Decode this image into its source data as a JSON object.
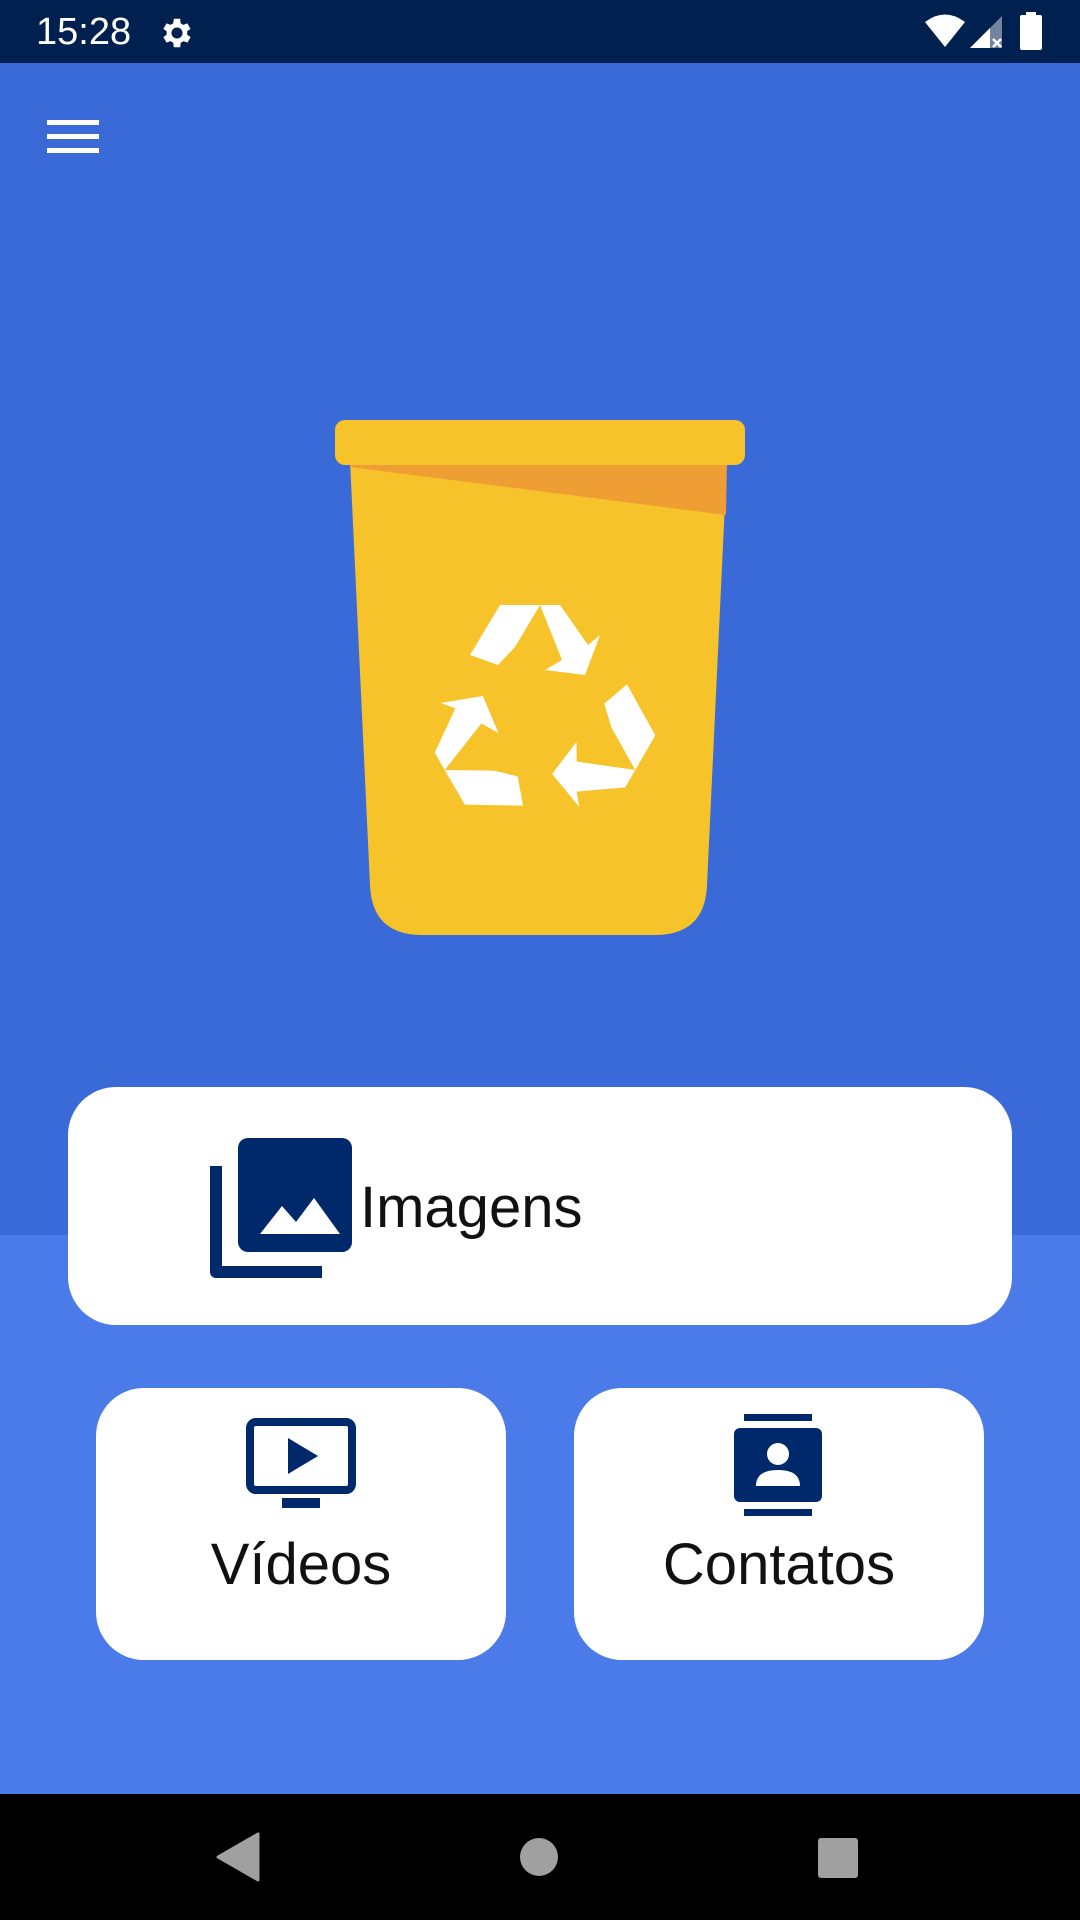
{
  "status_bar": {
    "time": "15:28",
    "icons": [
      "gear-icon",
      "wifi-icon",
      "cellular-signal-icon",
      "battery-icon"
    ]
  },
  "header": {
    "menu_icon": "hamburger-menu-icon"
  },
  "hero": {
    "illustration": "recycle-bin-icon",
    "colors": {
      "background": "#3a6ad8",
      "bin_yellow": "#f6c32a",
      "bin_orange": "#ee9e32"
    }
  },
  "buttons": {
    "images": {
      "label": "Imagens",
      "icon": "photo-library-icon"
    },
    "videos": {
      "label": "Vídeos",
      "icon": "video-screen-icon"
    },
    "contacts": {
      "label": "Contatos",
      "icon": "contact-card-icon"
    }
  },
  "nav_bar": {
    "icons": [
      "back-icon",
      "home-icon",
      "recents-icon"
    ]
  },
  "colors": {
    "status_bar": "#00204f",
    "lower_background": "#4b7be8",
    "icon_navy": "#00296b",
    "card": "#ffffff"
  }
}
